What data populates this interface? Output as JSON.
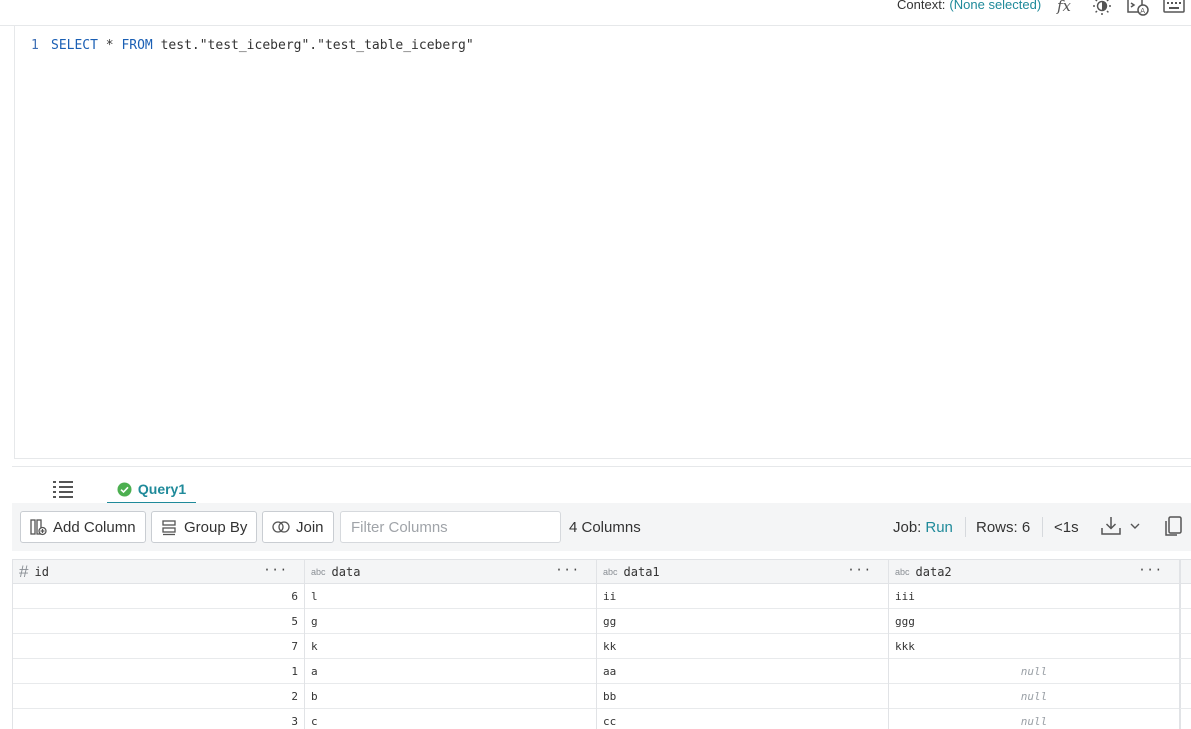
{
  "context": {
    "label": "Context:",
    "value": "(None selected)"
  },
  "top_icons": [
    "function-icon",
    "theme-toggle-icon",
    "ai-assist-icon",
    "keyboard-icon"
  ],
  "editor": {
    "line_number": "1",
    "code": {
      "select": "SELECT",
      "star": " * ",
      "from": "FROM",
      "rest": " test.\"test_iceberg\".\"test_table_iceberg\""
    }
  },
  "tabs": {
    "query_label": "Query1"
  },
  "toolbar": {
    "add_column": "Add Column",
    "group_by": "Group By",
    "join": "Join",
    "filter_placeholder": "Filter Columns",
    "columns_count": "4 Columns",
    "job_label": "Job:",
    "job_value": "Run",
    "rows_label": "Rows:",
    "rows_value": "6",
    "time": "<1s"
  },
  "grid": {
    "columns": [
      {
        "name": "id",
        "type": "#"
      },
      {
        "name": "data",
        "type": "abc"
      },
      {
        "name": "data1",
        "type": "abc"
      },
      {
        "name": "data2",
        "type": "abc"
      }
    ],
    "rows": [
      [
        "6",
        "l",
        "ii",
        "iii"
      ],
      [
        "5",
        "g",
        "gg",
        "ggg"
      ],
      [
        "7",
        "k",
        "kk",
        "kkk"
      ],
      [
        "1",
        "a",
        "aa",
        "null"
      ],
      [
        "2",
        "b",
        "bb",
        "null"
      ],
      [
        "3",
        "c",
        "cc",
        "null"
      ]
    ]
  },
  "colors": {
    "accent": "#1f8a9a",
    "success": "#4caf50"
  }
}
